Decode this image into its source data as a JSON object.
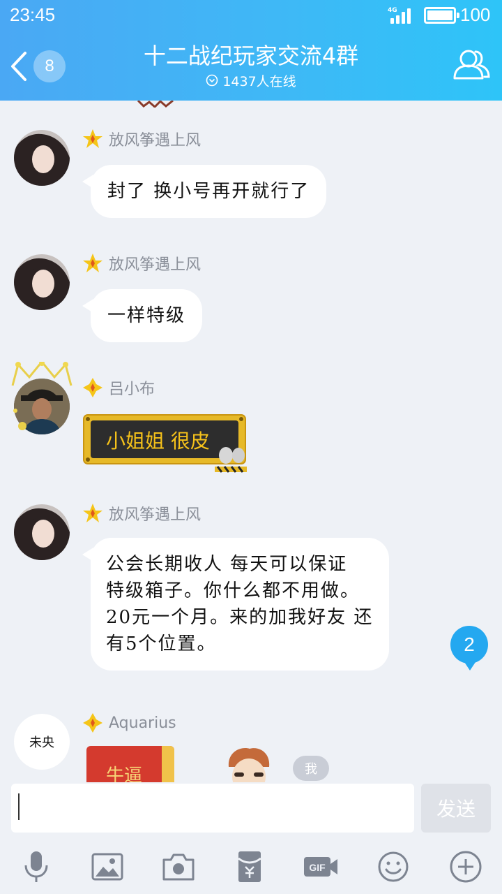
{
  "status_bar": {
    "time": "23:45",
    "network": "4G",
    "battery": "100"
  },
  "header": {
    "back_count": "8",
    "title": "十二战纪玩家交流4群",
    "online": "1437人在线"
  },
  "messages": [
    {
      "sender": "放风筝遇上风",
      "text": "封了 换小号再开就行了"
    },
    {
      "sender": "放风筝遇上风",
      "text": "一样特级"
    },
    {
      "sender": "吕小布",
      "text": "小姐姐 很皮"
    },
    {
      "sender": "放风筝遇上风",
      "text": "公会长期收人 每天可以保证 特级箱子。你什么都不用做。20元一个月。来的加我好友 还有5个位置。"
    },
    {
      "sender": "Aquarius",
      "avatar_text": "未央",
      "redpacket_text": "牛逼",
      "me_tag": "我"
    }
  ],
  "new_messages_count": "2",
  "input": {
    "placeholder": "",
    "send_label": "发送"
  },
  "toolbar": [
    {
      "icon": "microphone-icon"
    },
    {
      "icon": "image-icon"
    },
    {
      "icon": "camera-icon"
    },
    {
      "icon": "red-packet-icon"
    },
    {
      "icon": "gif-icon"
    },
    {
      "icon": "emoji-icon"
    },
    {
      "icon": "plus-icon"
    }
  ],
  "colors": {
    "header_start": "#4aa8f4",
    "header_end": "#2ec4f8",
    "background": "#eef1f6",
    "badge_blue": "#24a8f0"
  }
}
